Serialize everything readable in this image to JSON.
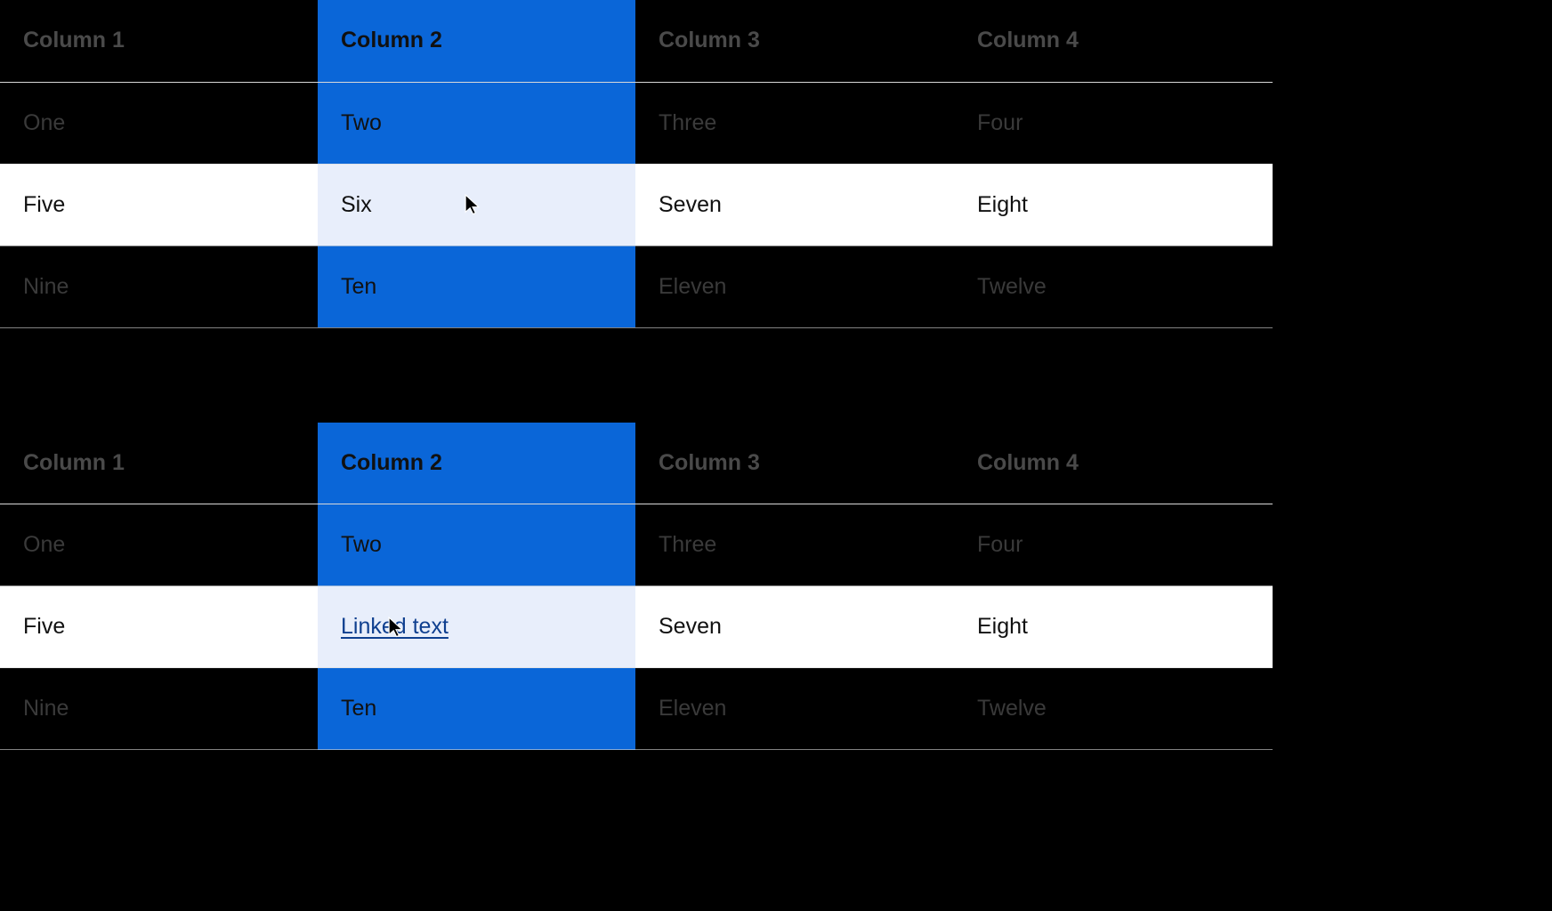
{
  "headers": {
    "c1": "Column 1",
    "c2": "Column 2",
    "c3": "Column 3",
    "c4": "Column 4"
  },
  "table1": {
    "r1": {
      "c1": "One",
      "c2": "Two",
      "c3": "Three",
      "c4": "Four"
    },
    "r2": {
      "c1": "Five",
      "c2": "Six",
      "c3": "Seven",
      "c4": "Eight"
    },
    "r3": {
      "c1": "Nine",
      "c2": "Ten",
      "c3": "Eleven",
      "c4": "Twelve"
    }
  },
  "table2": {
    "r1": {
      "c1": "One",
      "c2": "Two",
      "c3": "Three",
      "c4": "Four"
    },
    "r2": {
      "c1": "Five",
      "c2": "Linked text",
      "c3": "Seven",
      "c4": "Eight"
    },
    "r3": {
      "c1": "Nine",
      "c2": "Ten",
      "c3": "Eleven",
      "c4": "Twelve"
    }
  }
}
